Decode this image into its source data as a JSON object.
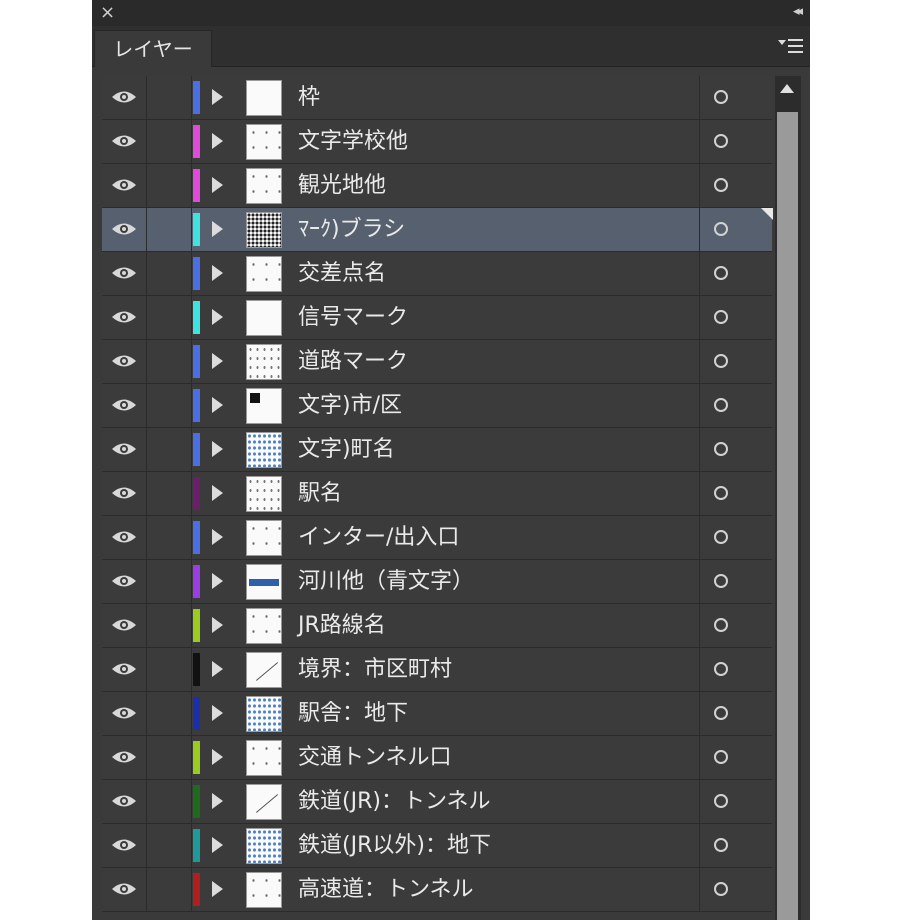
{
  "panel": {
    "tab_label": "レイヤー",
    "close_glyph": "×",
    "collapse_glyph": "◂◂"
  },
  "layers": [
    {
      "name": "枠",
      "color": "#4a6fe3",
      "thumb": "plain",
      "selected": false
    },
    {
      "name": "文字学校他",
      "color": "#e04ad8",
      "thumb": "sparse",
      "selected": false
    },
    {
      "name": "観光地他",
      "color": "#e04ad8",
      "thumb": "sparse",
      "selected": false
    },
    {
      "name": "ﾏｰｸ)ブラシ",
      "color": "#3ee3e0",
      "thumb": "dense",
      "selected": true
    },
    {
      "name": "交差点名",
      "color": "#4a6fe3",
      "thumb": "sparse",
      "selected": false
    },
    {
      "name": "信号マーク",
      "color": "#3ee3e0",
      "thumb": "plain",
      "selected": false
    },
    {
      "name": "道路マーク",
      "color": "#4a6fe3",
      "thumb": "dots",
      "selected": false
    },
    {
      "name": "文字)市/区",
      "color": "#4a6fe3",
      "thumb": "block",
      "selected": false
    },
    {
      "name": "文字)町名",
      "color": "#4a6fe3",
      "thumb": "blue",
      "selected": false
    },
    {
      "name": "駅名",
      "color": "#6b1f6b",
      "thumb": "dots",
      "selected": false
    },
    {
      "name": "インター/出入口",
      "color": "#4a6fe3",
      "thumb": "sparse",
      "selected": false
    },
    {
      "name": "河川他（青文字）",
      "color": "#9a3ee3",
      "thumb": "bluetext",
      "selected": false
    },
    {
      "name": "JR路線名",
      "color": "#9acc1e",
      "thumb": "sparse",
      "selected": false
    },
    {
      "name": "境界：市区町村",
      "color": "#111111",
      "thumb": "line",
      "selected": false
    },
    {
      "name": "駅舎：地下",
      "color": "#1a2fa8",
      "thumb": "blue",
      "selected": false
    },
    {
      "name": "交通トンネル口",
      "color": "#9acc1e",
      "thumb": "sparse",
      "selected": false
    },
    {
      "name": "鉄道(JR)：トンネル",
      "color": "#1e6b1e",
      "thumb": "line",
      "selected": false
    },
    {
      "name": "鉄道(JR以外)：地下",
      "color": "#1e9a9a",
      "thumb": "blue",
      "selected": false
    },
    {
      "name": "高速道：トンネル",
      "color": "#b01e1e",
      "thumb": "sparse",
      "selected": false
    }
  ]
}
